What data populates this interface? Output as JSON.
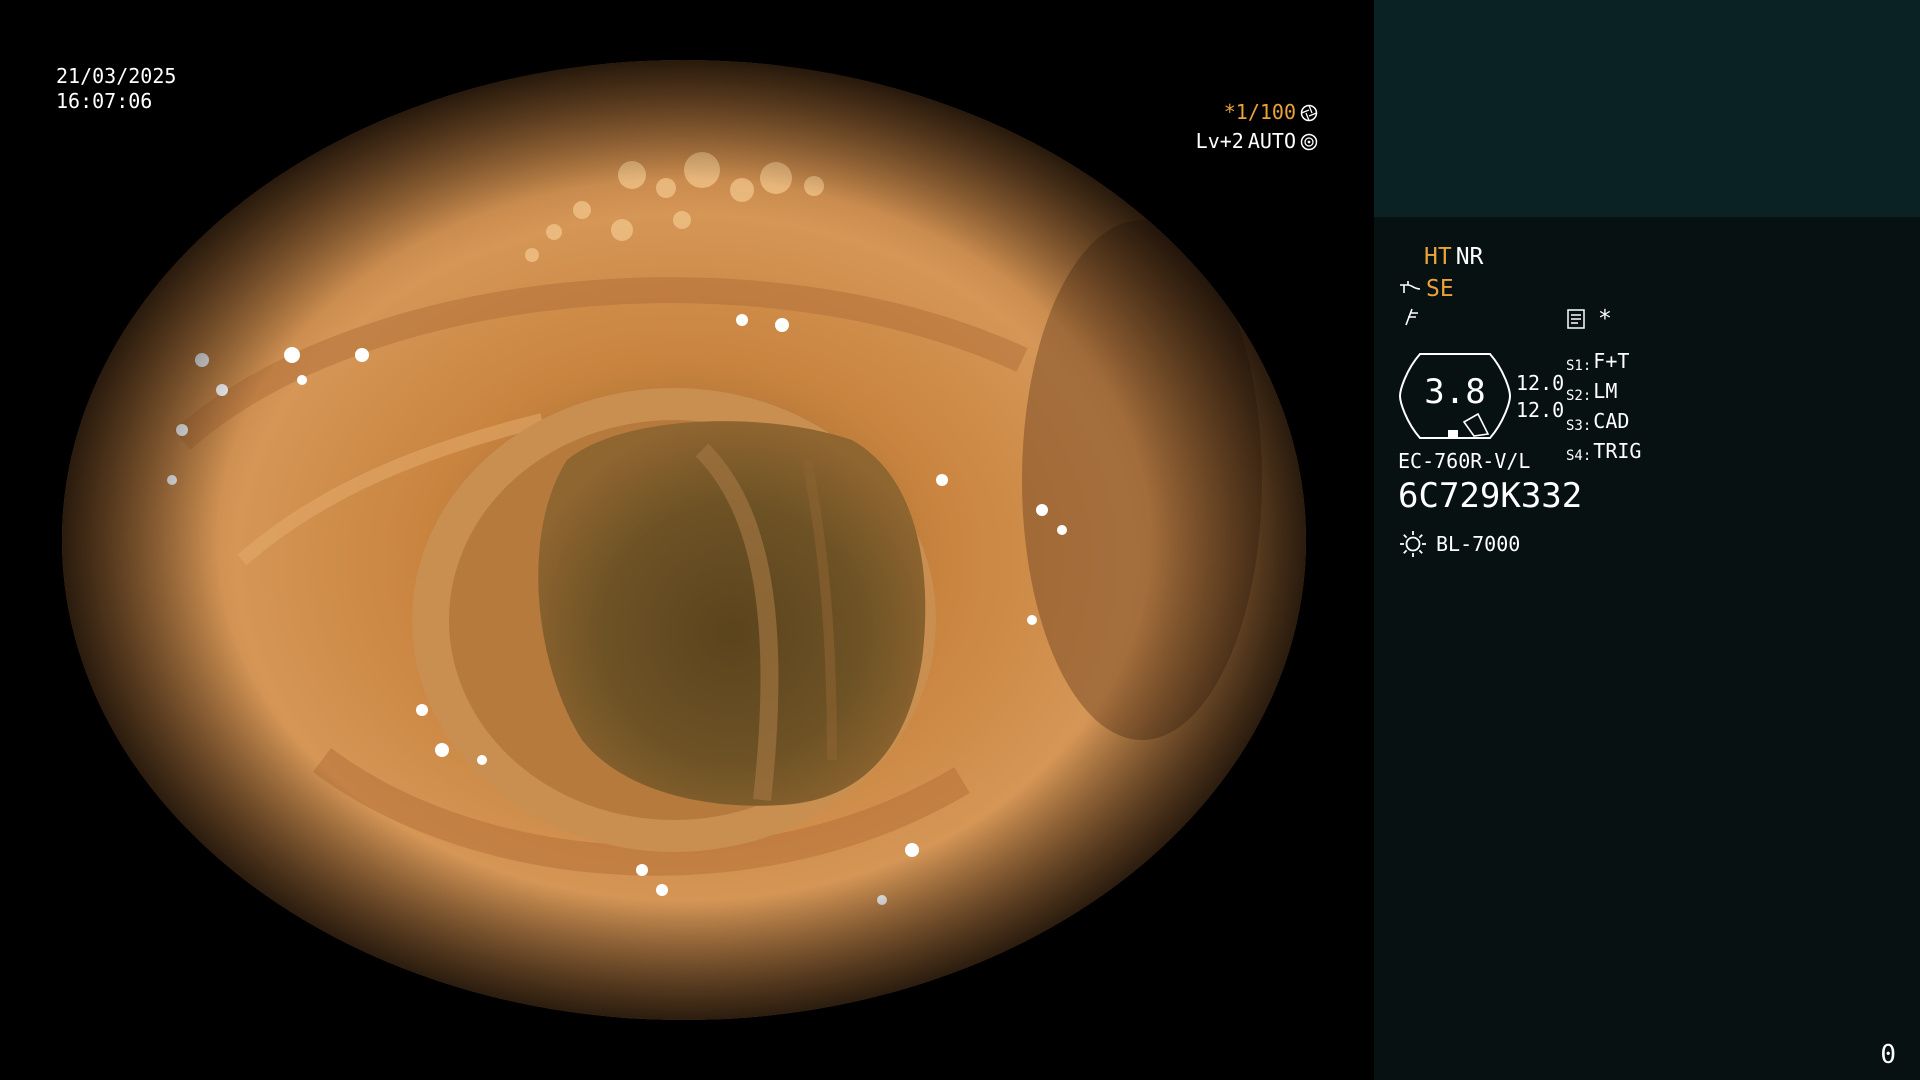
{
  "overlay": {
    "date": "21/03/2025",
    "time": "16:07:06",
    "shutter_label": "*1/100",
    "light_level": "Lv+2",
    "iris_mode": "AUTO",
    "shutter_icon": "aperture-icon",
    "iris_icon": "auto-iris-icon"
  },
  "panel": {
    "ht_label": "HT",
    "nr_label": "NR",
    "se_label": "SE",
    "se_icon": "enhance-curve-icon",
    "freeze_icon": "freeze-icon",
    "memo_icon": "memo-icon",
    "star_label": "*",
    "gauge_value": "3.8",
    "gauge_side_top": "12.0",
    "gauge_side_bottom": "12.0",
    "presets": [
      {
        "key": "S1:",
        "value": "F+T"
      },
      {
        "key": "S2:",
        "value": "LM"
      },
      {
        "key": "S3:",
        "value": "CAD"
      },
      {
        "key": "S4:",
        "value": "TRIG"
      }
    ],
    "scope_model": "EC-760R-V/L",
    "serial_number": "6C729K332",
    "light_source_icon": "sun-icon",
    "light_source": "BL-7000",
    "counter": "0"
  },
  "colors": {
    "accent": "#e9a33a",
    "panel_top": "#0b2224",
    "panel_bg": "#071112",
    "tissue_light": "#d99a5a",
    "tissue_dark": "#5a3415"
  }
}
